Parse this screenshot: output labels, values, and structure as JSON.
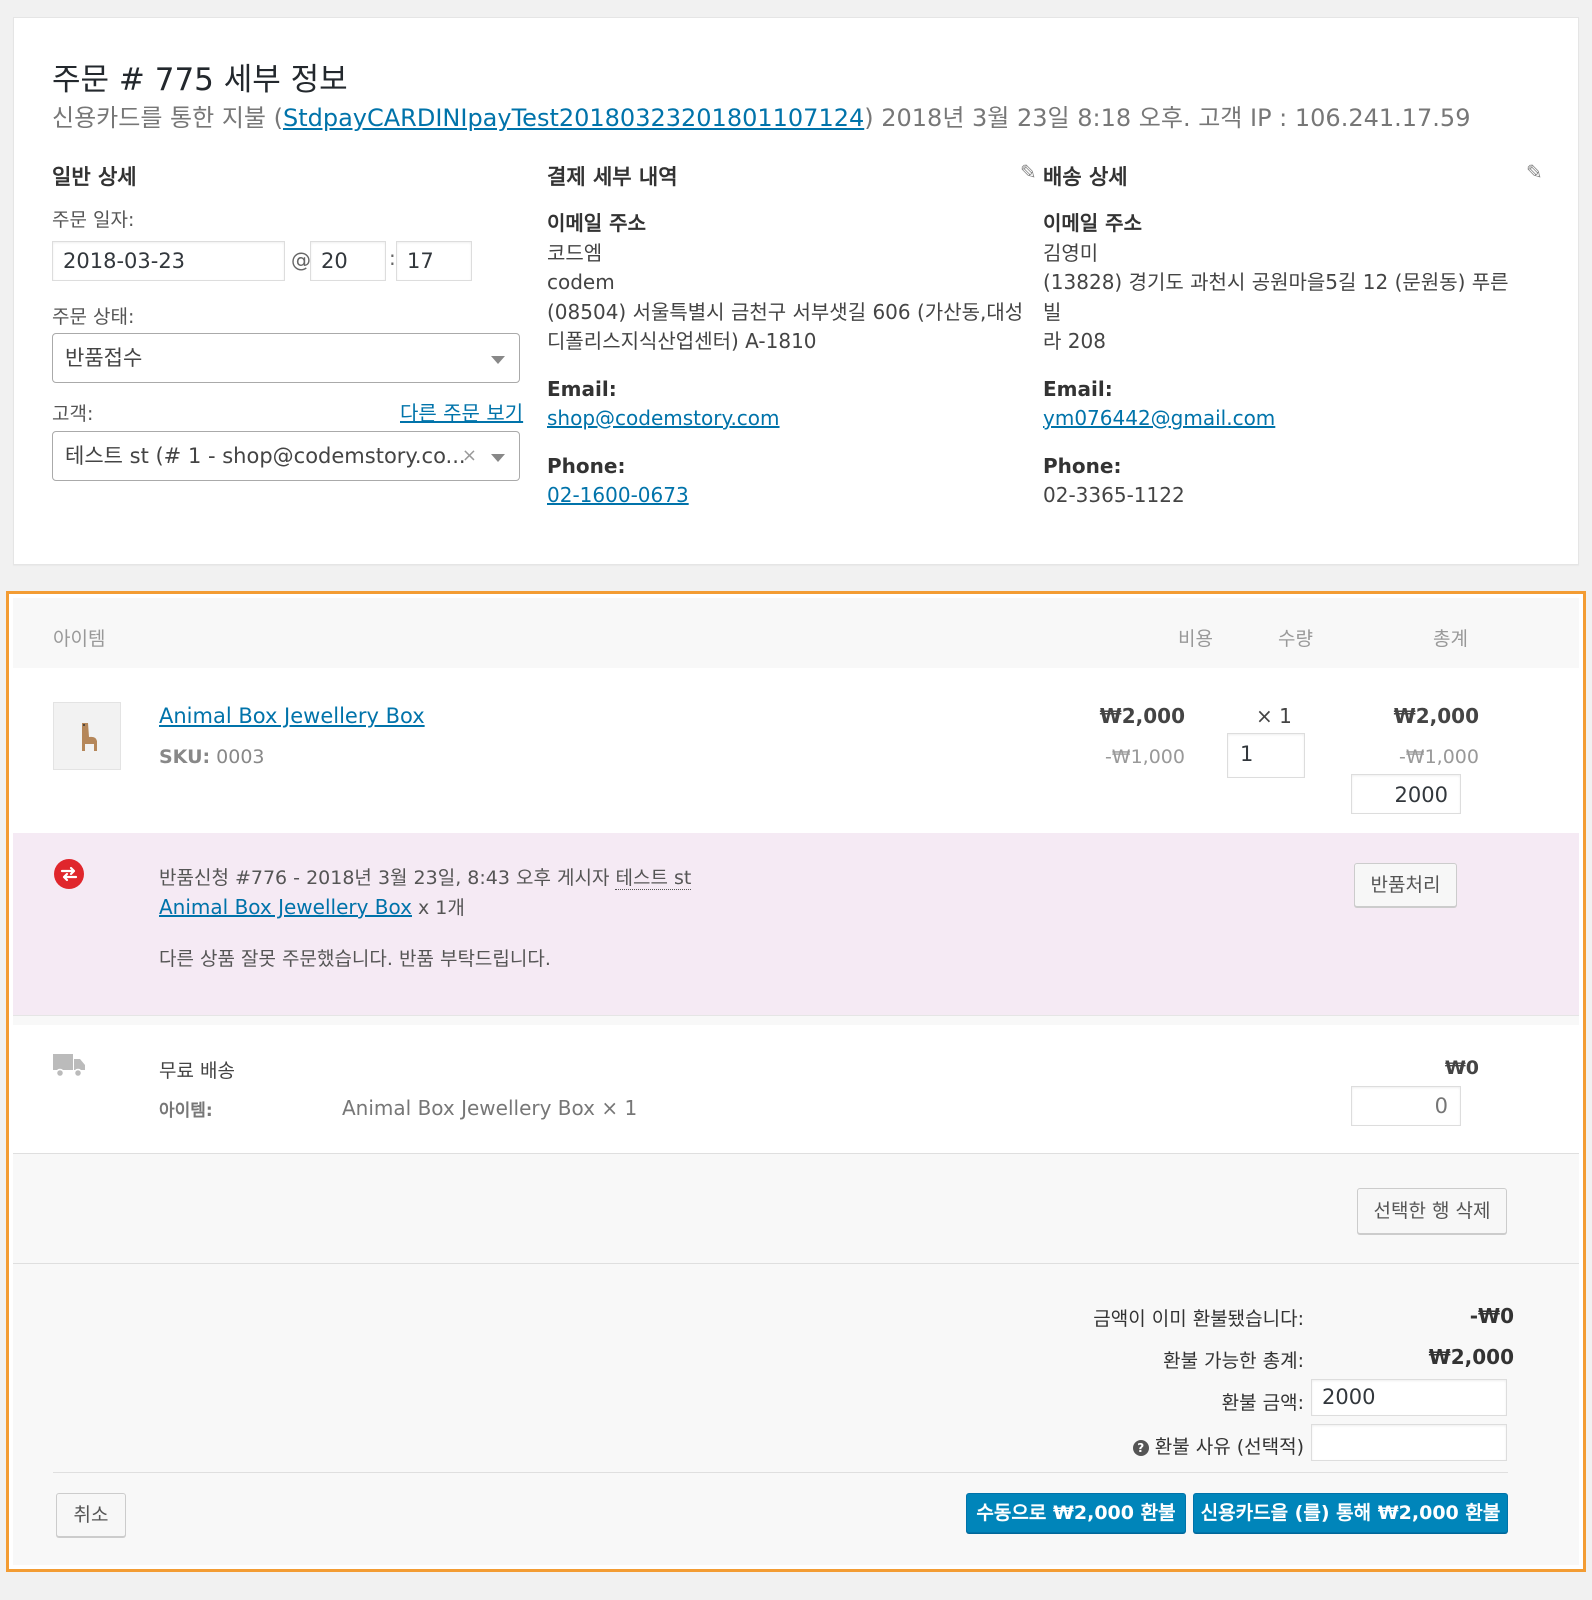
{
  "order": {
    "title": "주문 # 775 세부 정보",
    "sub_prefix": "신용카드를 통한 지불 (",
    "transaction_id": "StdpayCARDINIpayTest20180323201801107124",
    "sub_suffix": ") 2018년 3월 23일 8:18 오후. 고객 IP : 106.241.17.59"
  },
  "general": {
    "heading": "일반 상세",
    "date_label": "주문 일자:",
    "date": "2018-03-23",
    "at": "@",
    "hour": "20",
    "colon": ":",
    "minute": "17",
    "status_label": "주문 상태:",
    "status": "반품접수",
    "customer_label": "고객:",
    "other_orders": "다른 주문 보기",
    "customer": "테스트 st (# 1 - shop@codemstory.co...",
    "clear": "×"
  },
  "billing": {
    "heading": "결제 세부 내역",
    "email_addr_label": "이메일 주소",
    "lines": [
      "코드엠",
      "codem",
      "(08504) 서울특별시 금천구 서부샛길 606 (가산동,대성",
      "디폴리스지식산업센터) A-1810"
    ],
    "email_label": "Email:",
    "email": "shop@codemstory.com",
    "phone_label": "Phone:",
    "phone": "02-1600-0673"
  },
  "shipping": {
    "heading": "배송 상세",
    "email_addr_label": "이메일 주소",
    "lines": [
      "김영미",
      "(13828) 경기도 과천시 공원마을5길 12 (문원동) 푸른빌",
      "라 208"
    ],
    "email_label": "Email:",
    "email": "ym076442@gmail.com",
    "phone_label": "Phone:",
    "phone": "02-3365-1122"
  },
  "items": {
    "headers": {
      "item": "아이템",
      "cost": "비용",
      "qty": "수량",
      "total": "총계"
    },
    "product": {
      "name": "Animal Box Jewellery Box",
      "sku_label": "SKU:",
      "sku": "0003",
      "cost": "₩2,000",
      "cost_refund": "-₩1,000",
      "qty": "× 1",
      "qty_input": "1",
      "total": "₩2,000",
      "total_refund": "-₩1,000",
      "total_input": "2000"
    },
    "refund_request": {
      "line1_prefix": "반품신청 #776 - 2018년 3월 23일, 8:43 오후 게시자 ",
      "author": "테스트 st",
      "product_link": "Animal Box Jewellery Box",
      "product_qty": " x 1개",
      "message": "다른 상품 잘못 주문했습니다. 반품 부탁드립니다.",
      "button": "반품처리"
    },
    "shipping_line": {
      "name": "무료 배송",
      "items_label": "아이템:",
      "items_value": "Animal Box Jewellery Box × 1",
      "total": "₩0",
      "input_placeholder": "0"
    },
    "delete_button": "선택한 행 삭제"
  },
  "totals": {
    "already_refunded_label": "금액이 이미 환불됐습니다:",
    "already_refunded": "-₩0",
    "refundable_label": "환불 가능한 총계:",
    "refundable": "₩2,000",
    "refund_amount_label": "환불 금액:",
    "refund_amount": "2000",
    "reason_label": "환불 사유 (선택적)",
    "help_icon": "?"
  },
  "actions": {
    "cancel": "취소",
    "manual_refund": "수동으로 ₩2,000 환불",
    "card_refund": "신용카드을 (를) 통해 ₩2,000 환불"
  },
  "colors": {
    "accent": "#0073aa",
    "highlight": "#f39c33",
    "refund_bg": "#f5eaf4",
    "refund_icon": "#e0262c"
  }
}
